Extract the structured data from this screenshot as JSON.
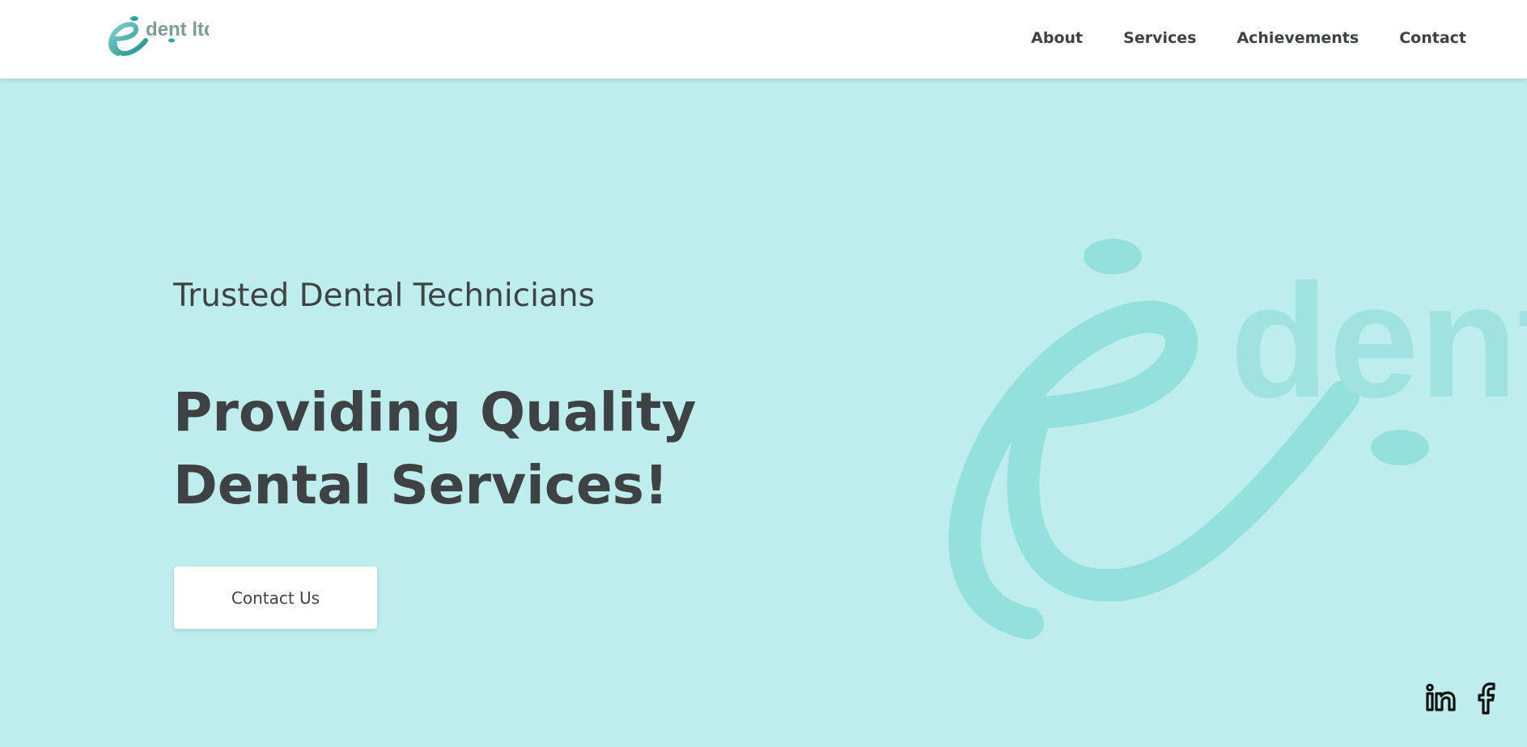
{
  "brand": {
    "logo_icon": "edent-logo",
    "logo_text": "dent ltd.",
    "logo_letter": "e",
    "accent_color": "#2aa8a4"
  },
  "nav": {
    "items": [
      {
        "label": "About"
      },
      {
        "label": "Services"
      },
      {
        "label": "Achievements"
      },
      {
        "label": "Contact"
      }
    ]
  },
  "hero": {
    "eyebrow": "Trusted Dental Technicians",
    "headline": "Providing Quality Dental Services!",
    "cta_label": "Contact Us",
    "background_color": "#bdeeed",
    "watermark_icon": "edent-logo-watermark",
    "watermark_text": "dent l"
  },
  "social": {
    "items": [
      {
        "icon": "linkedin-icon"
      },
      {
        "icon": "facebook-icon"
      }
    ]
  }
}
